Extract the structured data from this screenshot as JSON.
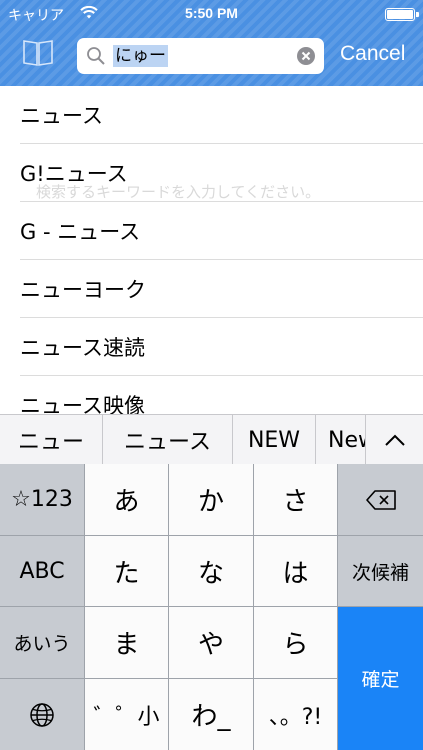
{
  "status_bar": {
    "carrier": "キャリア",
    "time": "5:50 PM"
  },
  "search": {
    "query": "にゅー",
    "placeholder": "検索するキーワードを入力してください。",
    "cancel_label": "Cancel"
  },
  "results": [
    "ニュース",
    "G!ニュース",
    "G - ニュース",
    "ニューヨーク",
    "ニュース速読",
    "ニュース映像"
  ],
  "candidates": [
    "ニュー",
    "ニュース",
    "NEW",
    "New"
  ],
  "keyboard": {
    "row1": [
      "☆123",
      "あ",
      "か",
      "さ"
    ],
    "row2": [
      "ABC",
      "た",
      "な",
      "は",
      "次候補"
    ],
    "row3": [
      "あいう",
      "ま",
      "や",
      "ら"
    ],
    "row4": [
      "゛゜小",
      "わ_",
      "、。?!"
    ],
    "confirm": "確定"
  },
  "colors": {
    "nav": "#4a90e2",
    "confirm": "#1a84f7",
    "key_dark": "#c7cbd1",
    "key_light": "#fbfbfb"
  }
}
